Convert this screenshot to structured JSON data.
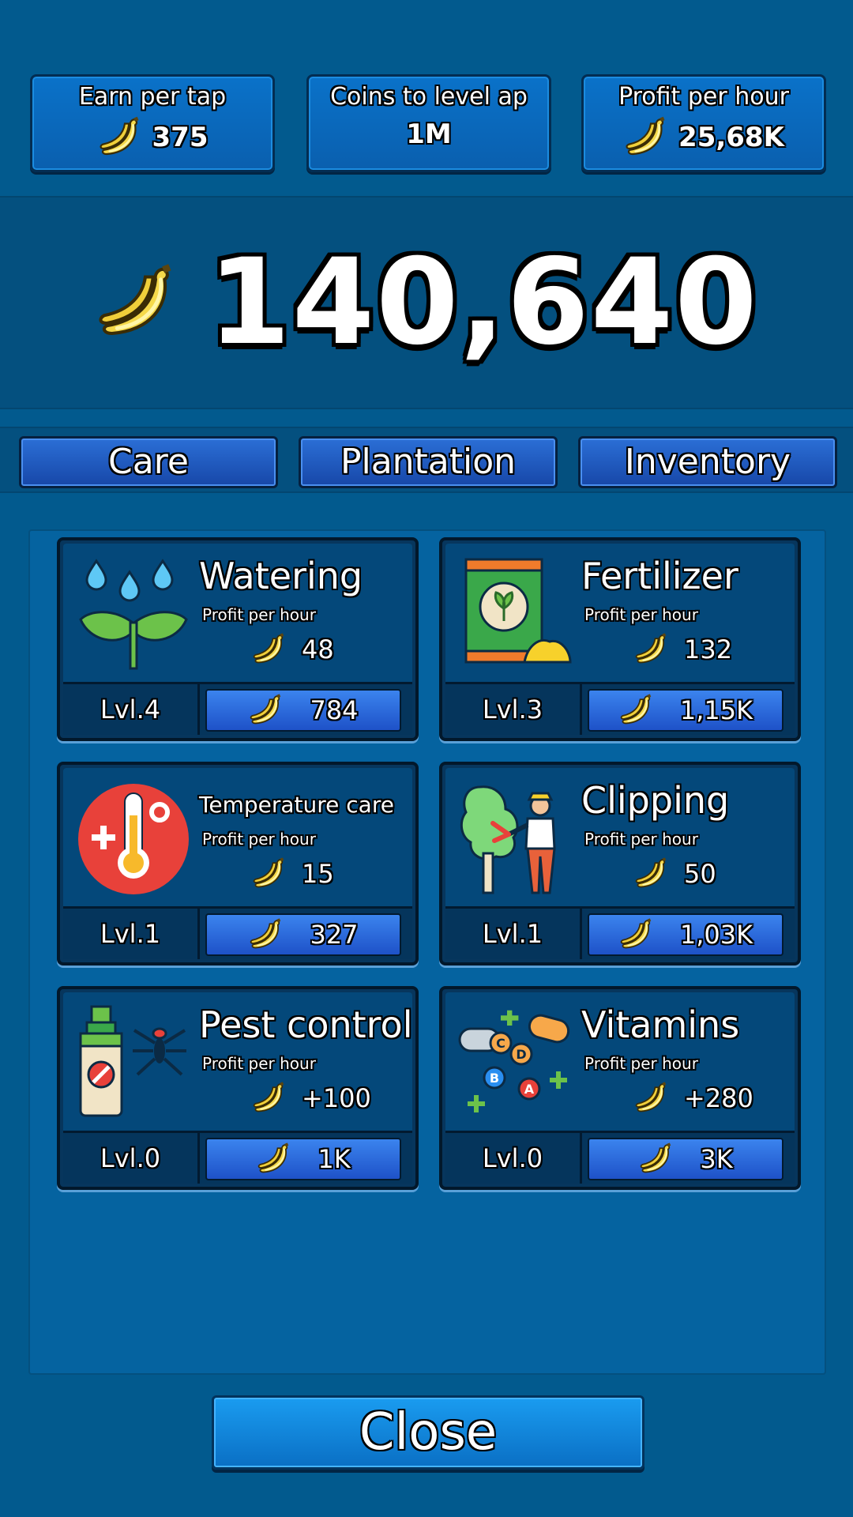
{
  "stats": [
    {
      "label": "Earn per tap",
      "value": "375",
      "icon": "banana-icon"
    },
    {
      "label": "Coins to level ap",
      "value": "1M"
    },
    {
      "label": "Profit per hour",
      "value": "25,68K",
      "icon": "banana-icon"
    }
  ],
  "balance": "140,640",
  "tabs": [
    "Care",
    "Plantation",
    "Inventory"
  ],
  "profit_label": "Profit per hour",
  "cards": [
    {
      "title": "Watering",
      "icon": "watering-plant-icon",
      "profit": "48",
      "level": "Lvl.4",
      "price": "784"
    },
    {
      "title": "Fertilizer",
      "icon": "fertilizer-bag-icon",
      "profit": "132",
      "level": "Lvl.3",
      "price": "1,15K"
    },
    {
      "title": "Temperature care",
      "icon": "thermometer-icon",
      "profit": "15",
      "level": "Lvl.1",
      "price": "327"
    },
    {
      "title": "Clipping",
      "icon": "gardener-clipping-icon",
      "profit": "50",
      "level": "Lvl.1",
      "price": "1,03K"
    },
    {
      "title": "Pest control",
      "icon": "pest-spray-icon",
      "profit": "+100",
      "level": "Lvl.0",
      "price": "1K"
    },
    {
      "title": "Vitamins",
      "icon": "vitamin-pills-icon",
      "profit": "+280",
      "level": "Lvl.0",
      "price": "3K"
    }
  ],
  "close_label": "Close",
  "colors": {
    "background": "#025a8e",
    "button": "#1a9cf0",
    "banana": "#f7e26b"
  }
}
